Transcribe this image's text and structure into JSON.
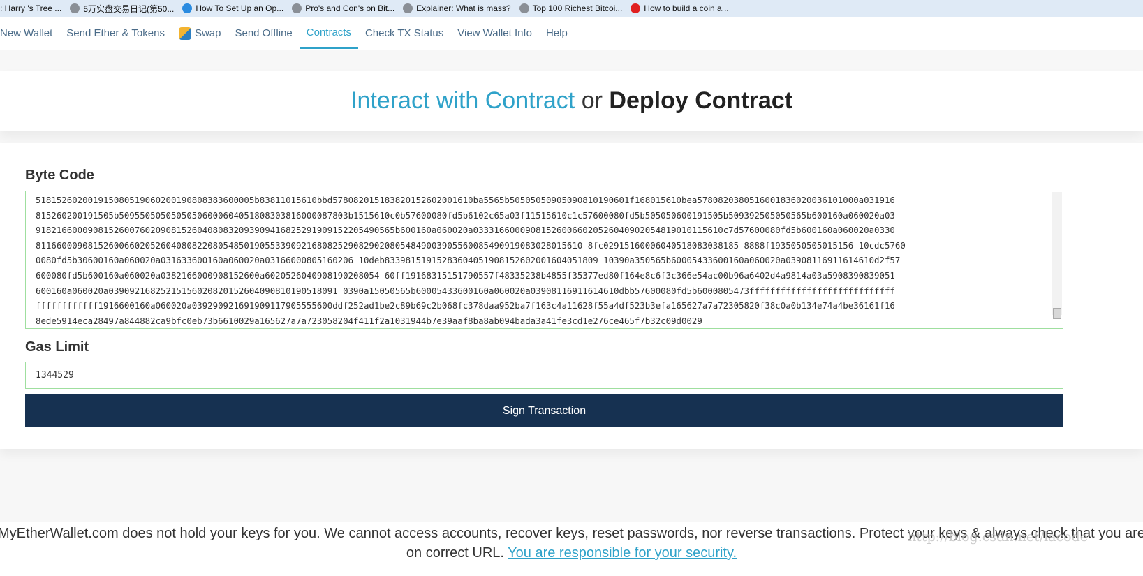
{
  "bookmarks": [
    ": Harry 's Tree ...",
    "5万实盘交易日记(第50...",
    "How To Set Up an Op...",
    "Pro's and Con's on Bit...",
    "Explainer: What is mass?",
    "Top 100 Richest Bitcoi...",
    "How to build a coin a..."
  ],
  "nav": [
    "New Wallet",
    "Send Ether & Tokens",
    "Swap",
    "Send Offline",
    "Contracts",
    "Check TX Status",
    "View Wallet Info",
    "Help"
  ],
  "hero": {
    "interact": "Interact with Contract",
    "or": "or",
    "deploy": "Deploy Contract"
  },
  "bytecode": {
    "label": "Byte Code",
    "lines": [
      "518152602001915080519060200190808383600005b83811015610bbd578082015183820152602001610ba5565b50505050905090810190601f168015610bea5780820380516001836020036101000a031916",
      "815260200191505b50955050505050506000604051808303816000087803b1515610c0b57600080fd5b6102c65a03f11515610c1c57600080fd5b505050600191505b509392505050565b600160a060020a03",
      "918216600090815260076020908152604080832093909416825291909152205490565b600160a060020a033316600090815260066020526040902054819010115610c7d57600080fd5b600160a060020a0330",
      "811660009081526006602052604080822080548501905533909216808252908290208054849003905560085490919083028015610 8fc02915160006040518083038185 8888f1935050505015156 10cdc5760",
      "0080fd5b30600160a060020a031633600160a060020a03166000805160206 10deb83398151915283604051908152602001604051809 10390a350565b60005433600160a060020a03908116911614610d2f57",
      "600080fd5b600160a060020a0382166000908152600a6020526040908190208054 60ff19168315151790557f48335238b4855f35377ed80f164e8c6f3c366e54ac00b96a6402d4a9814a03a5908390839051",
      "600160a060020a03909216825215156020820152604090810190518091 0390a15050565b60005433600160a060020a03908116911614610dbb57600080fd5b6000805473ffffffffffffffffffffffffffff",
      "ffffffffffff1916600160a060020a039290921691909117905555600ddf252ad1be2c89b69c2b068fc378daa952ba7f163c4a11628f55a4df523b3efa165627a7a72305820f38c0a0b134e74a4be36161f16",
      "8ede5914eca28497a844882ca9bfc0eb73b6610029a165627a7a723058204f411f2a1031944b7e39aaf8ba8ab094bada3a41fe3cd1e276ce465f7b32c09d0029"
    ]
  },
  "gas": {
    "label": "Gas Limit",
    "value": "1344529"
  },
  "sign_button": "Sign Transaction",
  "footer": {
    "text": "MyEtherWallet.com does not hold your keys for you. We cannot access accounts, recover keys, reset passwords, nor reverse transactions. Protect your keys & always check that you are on correct URL.",
    "link": "You are responsible for your security."
  },
  "watermark": "http://blog.csdn.net/lacode",
  "colors": {
    "accent": "#2fa2c9",
    "button": "#163151",
    "input_border": "#9fdf9f"
  }
}
